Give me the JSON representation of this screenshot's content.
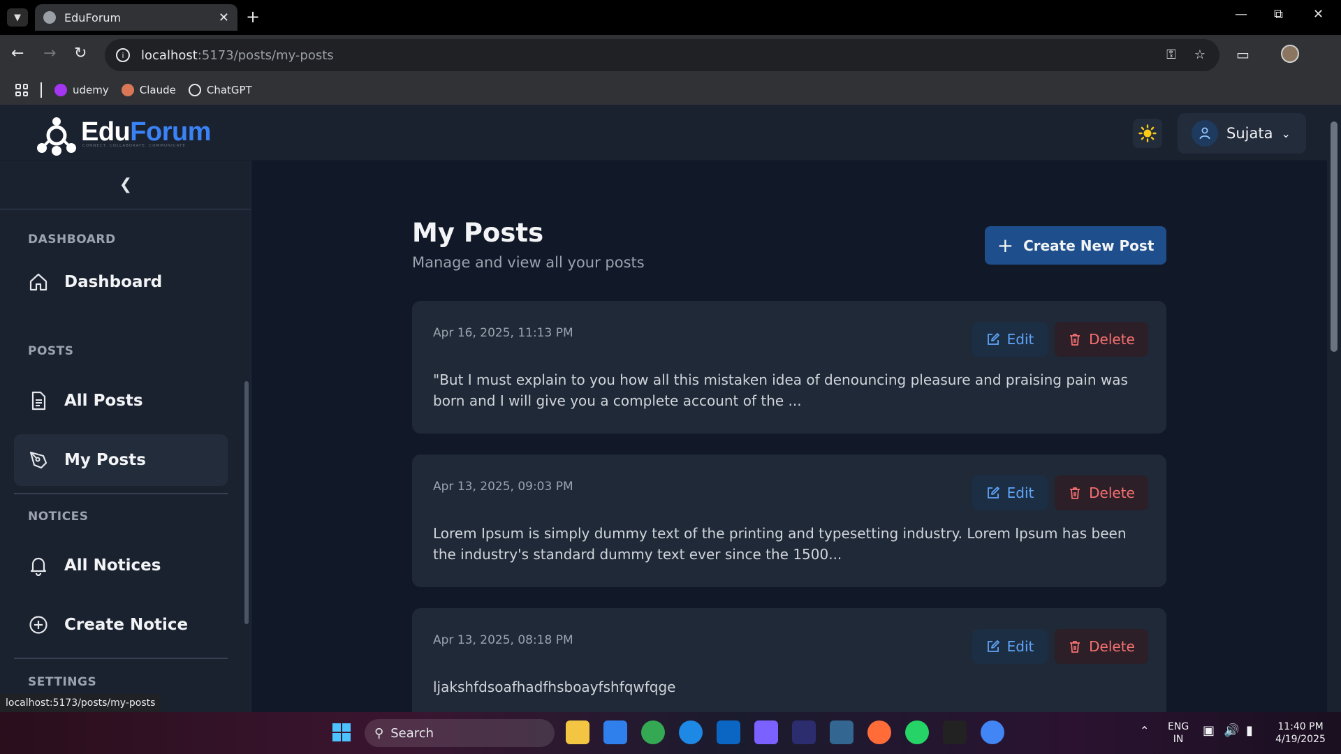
{
  "browser": {
    "tab_title": "EduForum",
    "url_host": "localhost",
    "url_path": ":5173/posts/my-posts",
    "bookmarks": [
      {
        "label": "udemy",
        "color": "#a435f0"
      },
      {
        "label": "Claude",
        "color": "#d97757"
      },
      {
        "label": "ChatGPT",
        "color": "#e8eaed"
      }
    ],
    "status_url": "localhost:5173/posts/my-posts"
  },
  "header": {
    "logo_part1": "Edu",
    "logo_part2": "Forum",
    "logo_tagline": "CONNECT. COLLABORATE. COMMUNICATE",
    "user_name": "Sujata"
  },
  "sidebar": {
    "sections": {
      "dashboard": "DASHBOARD",
      "posts": "POSTS",
      "notices": "NOTICES",
      "settings": "SETTINGS"
    },
    "items": {
      "dashboard": "Dashboard",
      "all_posts": "All Posts",
      "my_posts": "My Posts",
      "all_notices": "All Notices",
      "create_notice": "Create Notice"
    }
  },
  "main": {
    "title": "My Posts",
    "subtitle": "Manage and view all your posts",
    "create_button": "Create New Post",
    "edit_label": "Edit",
    "delete_label": "Delete",
    "posts": [
      {
        "date": "Apr 16, 2025, 11:13 PM",
        "body": "\"But I must explain to you how all this mistaken idea of denouncing pleasure and praising pain was born and I will give you a complete account of the ..."
      },
      {
        "date": "Apr 13, 2025, 09:03 PM",
        "body": "Lorem Ipsum is simply dummy text of the printing and typesetting industry. Lorem Ipsum has been the industry's standard dummy text ever since the 1500..."
      },
      {
        "date": "Apr 13, 2025, 08:18 PM",
        "body": "ljakshfdsoafhadfhsboayfshfqwfqge"
      }
    ]
  },
  "taskbar": {
    "search_label": "Search",
    "lang_line1": "ENG",
    "lang_line2": "IN",
    "time": "11:40 PM",
    "date": "4/19/2025"
  },
  "colors": {
    "accent": "#3b82f6",
    "primary_button": "#1e4f8c",
    "danger": "#f87171",
    "background": "#111827",
    "card": "#1f2937"
  }
}
